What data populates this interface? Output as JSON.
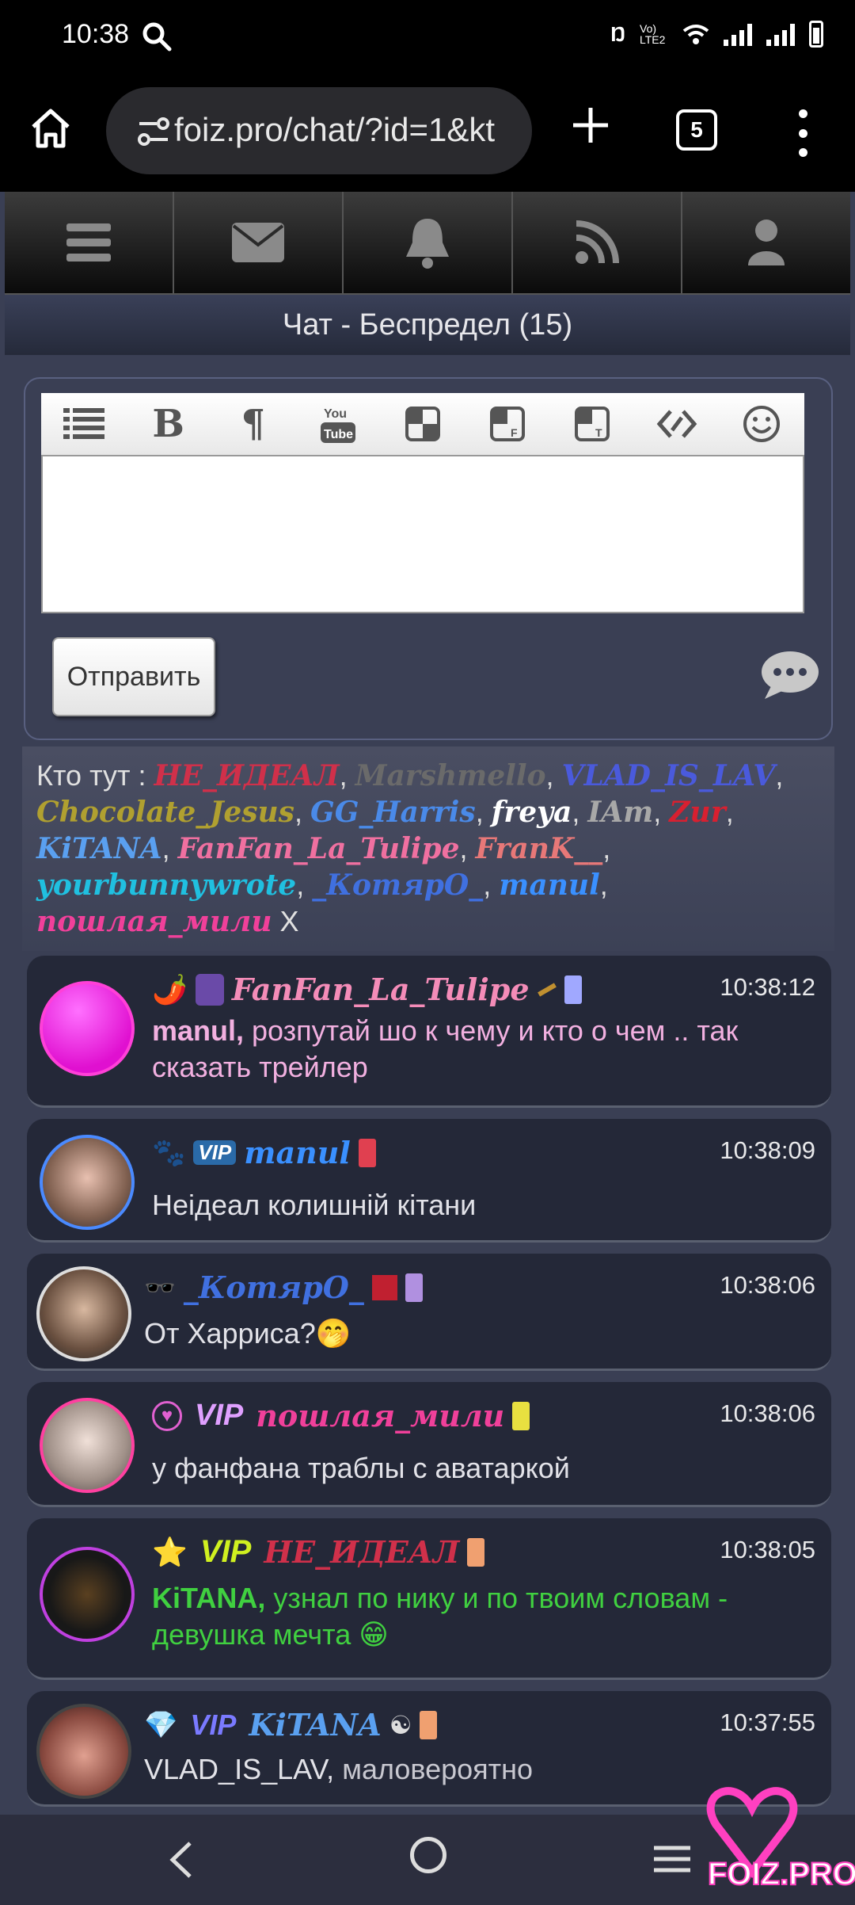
{
  "status": {
    "time": "10:38",
    "lte": "Vo) LTE2"
  },
  "browser": {
    "url": "foiz.pro/chat/?id=1&kt",
    "tab_count": "5"
  },
  "nav": {
    "items": [
      "menu-icon",
      "mail-icon",
      "bell-icon",
      "rss-icon",
      "user-icon"
    ]
  },
  "page": {
    "title": "Чат - Беспредел (15)"
  },
  "editor": {
    "send_label": "Отправить"
  },
  "online": {
    "label": "Кто тут :",
    "users": [
      {
        "name": "НЕ_ИДЕАЛ",
        "color": "#d0304a"
      },
      {
        "name": "Marshmello",
        "color": "#6a6a6a"
      },
      {
        "name": "VLAD_IS_LAV",
        "color": "#4a5adc"
      },
      {
        "name": "Chocolate_Jesus",
        "color": "#b0a030"
      },
      {
        "name": "GG_Harris",
        "color": "#4a8ae8"
      },
      {
        "name": "freya",
        "color": "#ffffff"
      },
      {
        "name": "IAm",
        "color": "#a8a8a8"
      },
      {
        "name": "Zur",
        "color": "#d82030"
      },
      {
        "name": "KiTANA",
        "color": "#5aa0f0"
      },
      {
        "name": "FanFan_La_Tulipe",
        "color": "#f070a0"
      },
      {
        "name": "FranK__",
        "color": "#e87878"
      },
      {
        "name": "yourbunnywrote",
        "color": "#20c0e0"
      },
      {
        "name": "_КотярО_",
        "color": "#4070e0"
      },
      {
        "name": "manul",
        "color": "#3a90ff"
      },
      {
        "name": "пошлая_мили",
        "color": "#f0409a"
      }
    ],
    "close": "X"
  },
  "messages": [
    {
      "nick": "FanFan_La_Tulipe",
      "time": "10:38:12",
      "to": "manul,",
      "text": "розпутай шо к чему и кто о чем .. так сказать трейлер",
      "text_color": "#f2b0e0",
      "to_color": "#f2b0e0"
    },
    {
      "nick": "manul",
      "time": "10:38:09",
      "to": "",
      "text": "Неідеал колишній кітани",
      "text_color": "#e2e2e8",
      "to_color": "#e2e2e8"
    },
    {
      "nick": "_КотярО_",
      "time": "10:38:06",
      "to": "",
      "text": "От Харриса?🤭",
      "text_color": "#e2e2e8",
      "to_color": "#e2e2e8"
    },
    {
      "nick": "пошлая_мили",
      "time": "10:38:06",
      "to": "",
      "text": "у фанфана траблы с аватаркой",
      "text_color": "#e2e2e8",
      "to_color": "#e2e2e8"
    },
    {
      "nick": "НЕ_ИДЕАЛ",
      "time": "10:38:05",
      "to": "KiTANA,",
      "text": "узнал по нику и по твоим словам - девушка мечта 😁",
      "text_color": "#40d040",
      "to_color": "#40d040"
    },
    {
      "nick": "KiTANA",
      "time": "10:37:55",
      "to": "VLAD_IS_LAV,",
      "text": "маловероятно",
      "text_color": "#e2e2e8",
      "to_color": "#e2e2e8"
    }
  ],
  "badges": {
    "vip": "VIP",
    "pepper": "🌶️",
    "paw": "🐾",
    "glasses": "🕶️",
    "star": "⭐",
    "diamond": "💎",
    "yin_yang": "☯"
  },
  "watermark": "FOIZ.PRO"
}
